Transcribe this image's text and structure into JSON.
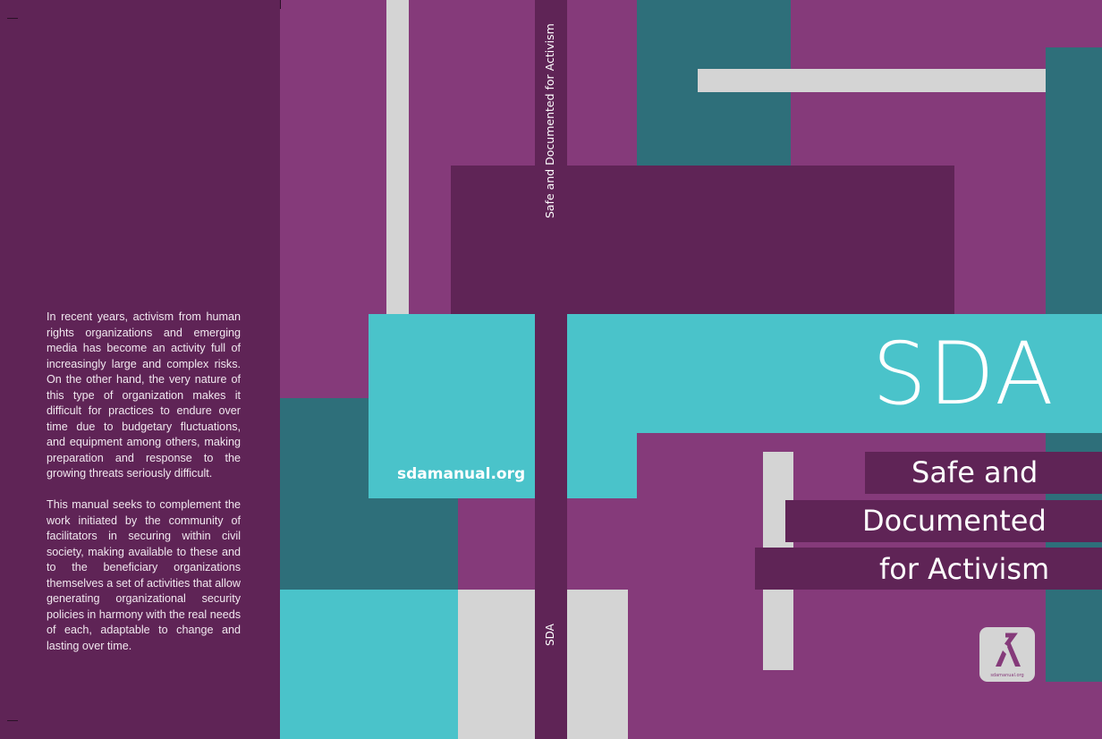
{
  "back_cover": {
    "paragraph_1": "In recent years, activism from human rights organizations and emerging media has become an activity full of increasingly large and complex risks. On the other hand, the very nature of this type of organization makes it difficult for practices to endure over time due to budgetary fluctuations, and equipment among others, making preparation and response to the growing threats seriously difficult.",
    "paragraph_2": "This manual seeks to complement the work initiated by the community of facilitators in securing within civil society, making available to these and to the beneficiary organizations themselves a set of activities that allow generating organizational security policies in harmony with the real needs of each, adaptable to change and lasting over time."
  },
  "spine": {
    "title": "Safe and Documented for Activism",
    "acronym": "SDA"
  },
  "front_cover": {
    "acronym": "SDA",
    "website": "sdamanual.org",
    "title_lines": [
      "Safe and",
      "Documented",
      "for Activism"
    ],
    "logo_caption": "sdamanual.org"
  },
  "colors": {
    "dark_purple": "#5f2456",
    "purple": "#853a7a",
    "teal": "#2e6f7a",
    "cyan": "#4ac3ca",
    "light_gray": "#d4d4d4"
  }
}
